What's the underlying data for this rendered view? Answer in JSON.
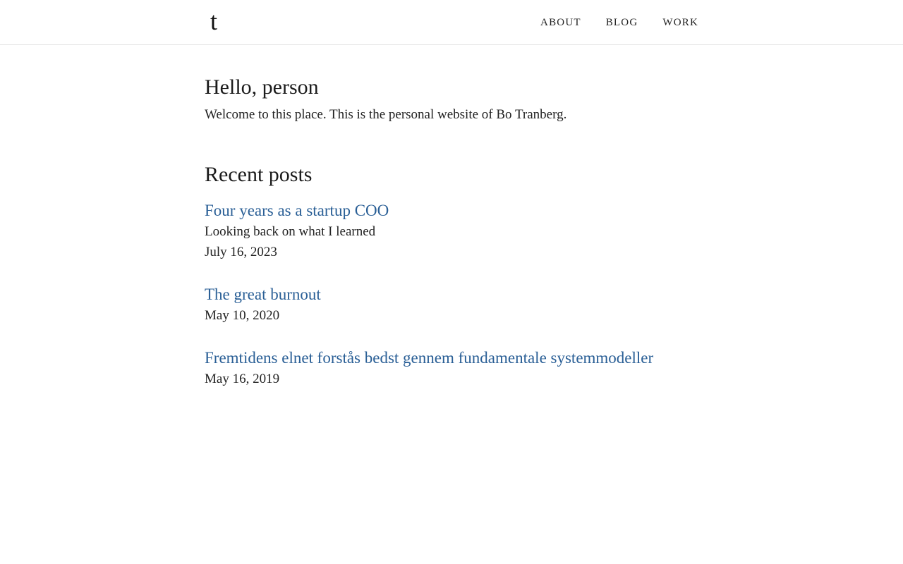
{
  "site": {
    "logo": "t",
    "nav": [
      {
        "label": "About"
      },
      {
        "label": "Blog"
      },
      {
        "label": "Work"
      }
    ]
  },
  "intro": {
    "heading": "Hello, person",
    "text": "Welcome to this place. This is the personal website of Bo Tranberg."
  },
  "recent": {
    "heading": "Recent posts",
    "posts": [
      {
        "title": "Four years as a startup COO",
        "subtitle": "Looking back on what I learned",
        "date": "July 16, 2023"
      },
      {
        "title": "The great burnout",
        "date": "May 10, 2020"
      },
      {
        "title": "Fremtidens elnet forstås bedst gennem fundamentale systemmodeller",
        "date": "May 16, 2019"
      }
    ]
  },
  "colors": {
    "link": "#2a5f96",
    "text": "#1f1f1f",
    "divider": "#e2e2e2"
  }
}
